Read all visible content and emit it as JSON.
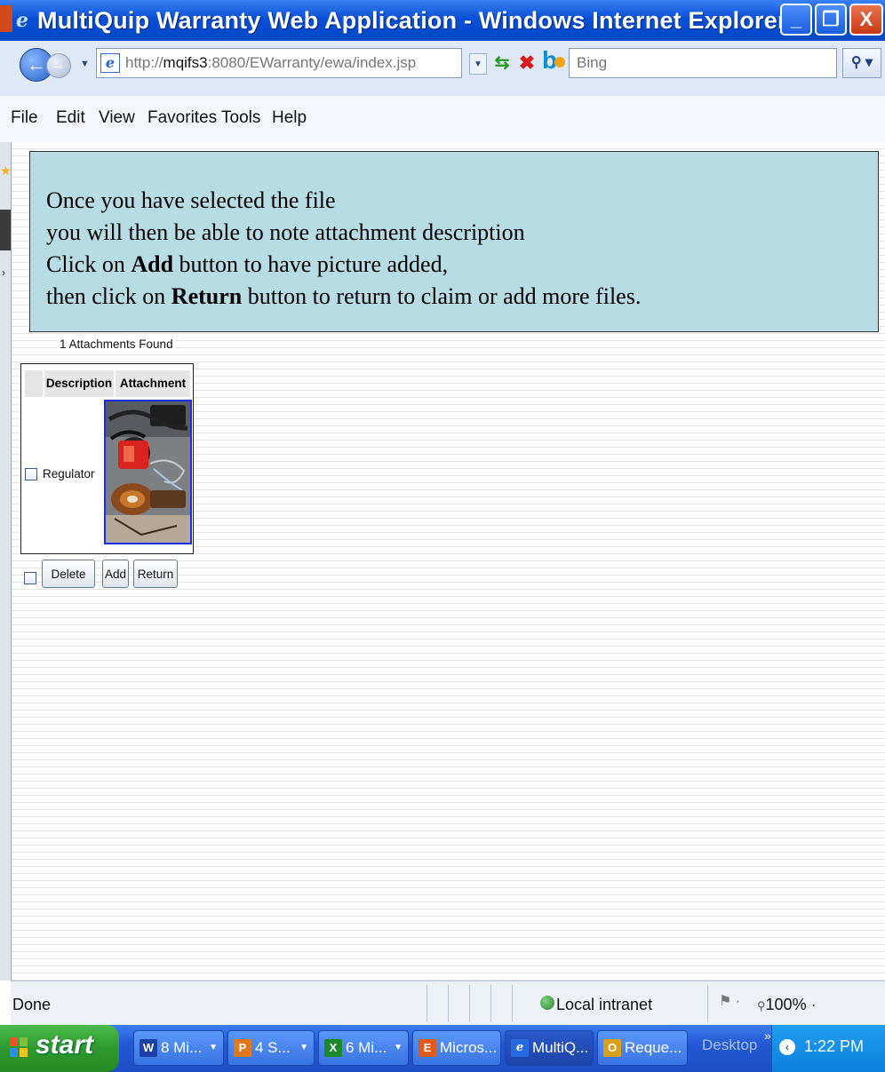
{
  "window": {
    "title": "MultiQuip Warranty Web Application - Windows Internet Explorer",
    "minimize": "_",
    "maximize": "❐",
    "close": "X"
  },
  "navbar": {
    "address_host": "mqifs3",
    "address_rest": ":8080/EWarranty/ewa/index.jsp",
    "search_placeholder": "Bing",
    "search_icon": "search-icon"
  },
  "menu": [
    "File",
    "Edit",
    "View",
    "Favorites",
    "Tools",
    "Help"
  ],
  "callout": {
    "line1": "Once you have selected the file",
    "line2": "you will then be able to note attachment description",
    "line3_pre": "Click on ",
    "line3_bold": "Add",
    "line3_post": " button to have picture added,",
    "line4_pre": "then  click on ",
    "line4_bold": "Return",
    "line4_post": " button to return to claim or add more files."
  },
  "attachments": {
    "count_label": "1 Attachments Found",
    "columns": [
      "Description",
      "Attachment"
    ],
    "rows": [
      {
        "description": "Regulator",
        "attachment_icon": "image-thumbnail"
      }
    ]
  },
  "buttons": {
    "delete": "Delete",
    "add": "Add",
    "return": "Return"
  },
  "statusbar": {
    "status": "Done",
    "zone": "Local intranet",
    "zoom": "100%"
  },
  "taskbar": {
    "start": "start",
    "tasks": [
      {
        "label": "8 Mi...",
        "icon": "W",
        "color": "#1c3fa8"
      },
      {
        "label": "4 S...",
        "icon": "P",
        "color": "#e07a1a"
      },
      {
        "label": "6 Mi...",
        "icon": "X",
        "color": "#1a8a2a"
      },
      {
        "label": "Micros...",
        "icon": "E",
        "color": "#e05a1a"
      },
      {
        "label": "MultiQ...",
        "icon": "e",
        "color": "#2a6ae0"
      },
      {
        "label": "Reque...",
        "icon": "O",
        "color": "#d8a01a"
      }
    ],
    "desktop": "Desktop",
    "clock": "1:22 PM"
  },
  "colors": {
    "callout_bg": "#b8dce3",
    "titlebar": "#0a4fd6",
    "taskbar": "#2458d4",
    "start_green": "#2e9a2e"
  }
}
